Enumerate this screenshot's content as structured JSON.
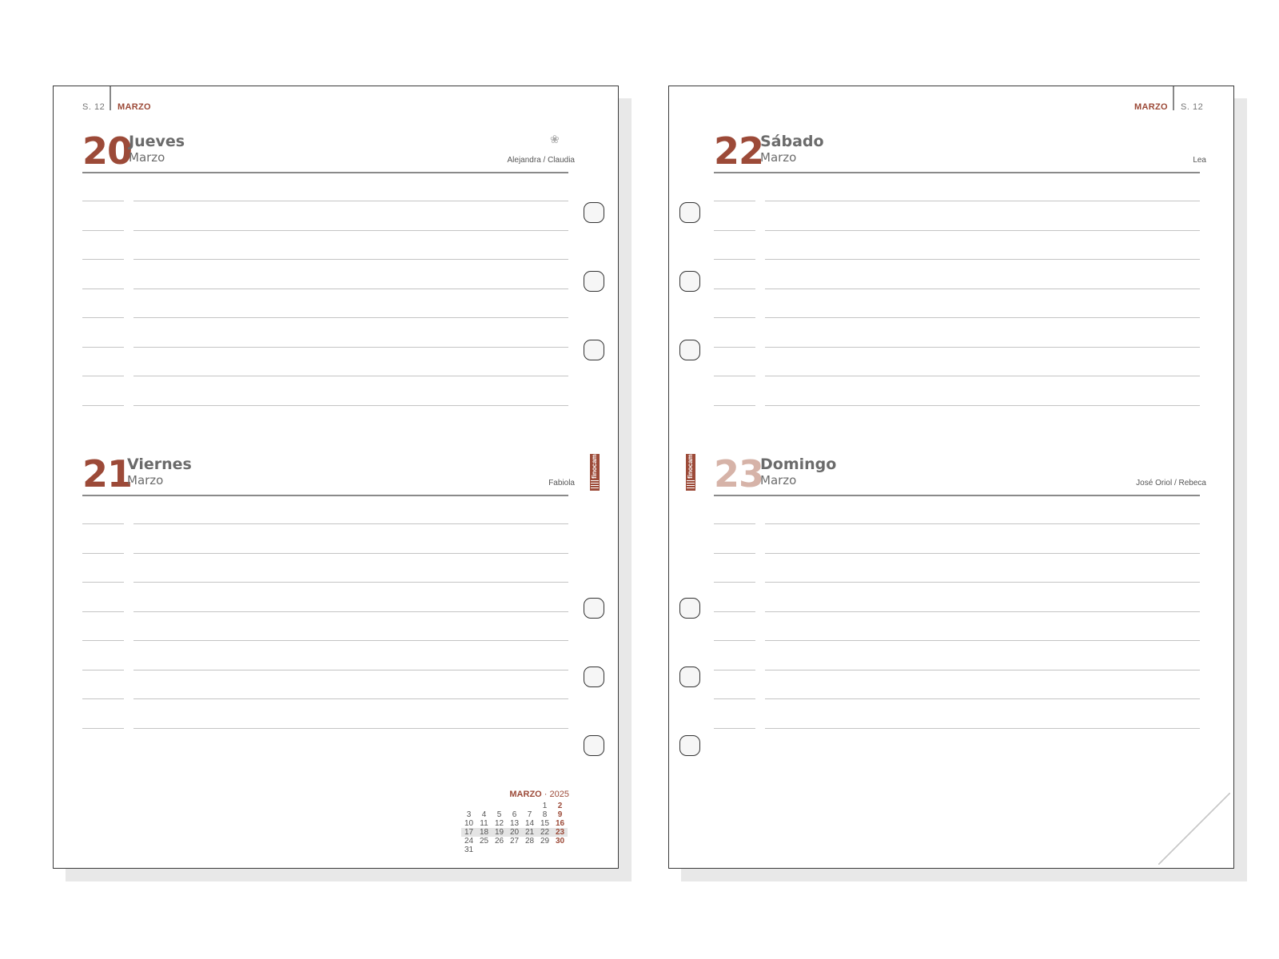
{
  "left_page": {
    "week_label": "S. 12",
    "month_tag": "MARZO",
    "days": [
      {
        "number": "20",
        "name": "Jueves",
        "month": "Marzo",
        "saints": "Alejandra / Claudia"
      },
      {
        "number": "21",
        "name": "Viernes",
        "month": "Marzo",
        "saints": "Fabiola"
      }
    ],
    "brand": "finocam",
    "mini_calendar": {
      "month": "MARZO",
      "separator": "·",
      "year": "2025",
      "weeks": [
        [
          "",
          "",
          "",
          "",
          "",
          "1",
          "2"
        ],
        [
          "3",
          "4",
          "5",
          "6",
          "7",
          "8",
          "9"
        ],
        [
          "10",
          "11",
          "12",
          "13",
          "14",
          "15",
          "16"
        ],
        [
          "17",
          "18",
          "19",
          "20",
          "21",
          "22",
          "23"
        ],
        [
          "24",
          "25",
          "26",
          "27",
          "28",
          "29",
          "30"
        ],
        [
          "31",
          "",
          "",
          "",
          "",
          "",
          ""
        ]
      ]
    }
  },
  "right_page": {
    "week_label": "S. 12",
    "month_tag": "MARZO",
    "days": [
      {
        "number": "22",
        "name": "Sábado",
        "month": "Marzo",
        "saints": "Lea"
      },
      {
        "number": "23",
        "name": "Domingo",
        "month": "Marzo",
        "saints": "José Oriol / Rebeca"
      }
    ],
    "brand": "finocam"
  },
  "colors": {
    "accent": "#9c4a38",
    "sunday_number": "#d6b3a8",
    "text_gray": "#6b6b6b",
    "border": "#3a3a3a"
  }
}
